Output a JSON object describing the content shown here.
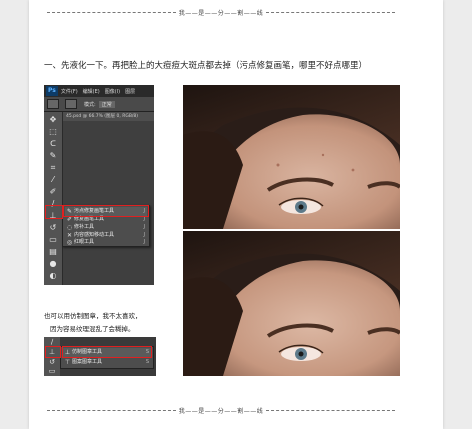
{
  "divider_text": "我——是——分——割——线",
  "heading": "一、先液化一下。再把脸上的大痘痘大斑点都去掉（污点修复画笔，哪里不好点哪里）",
  "ps1": {
    "logo": "Ps",
    "menus": [
      "文件(F)",
      "编辑(E)",
      "图像(I)",
      "图层"
    ],
    "options": [
      "模式:",
      "正常"
    ],
    "doc_tab": "45.psd @ 66.7% (图层 0, RGB/8)",
    "flyout": [
      {
        "icon": "spot-healing-brush-icon",
        "label": "污点修复画笔工具",
        "key": "J",
        "selected": true
      },
      {
        "icon": "healing-brush-icon",
        "label": "修复画笔工具",
        "key": "J",
        "selected": false
      },
      {
        "icon": "patch-icon",
        "label": "修补工具",
        "key": "J",
        "selected": false
      },
      {
        "icon": "content-aware-move-icon",
        "label": "内容感知移动工具",
        "key": "J",
        "selected": false
      },
      {
        "icon": "red-eye-icon",
        "label": "红眼工具",
        "key": "J",
        "selected": false
      }
    ]
  },
  "caption": {
    "line1": "也可以用仿制图章，我不太喜欢，",
    "line2": "因为容易纹理混乱了会糊掉。"
  },
  "ps2": {
    "flyout": [
      {
        "icon": "clone-stamp-icon",
        "label": "仿制图章工具",
        "key": "S",
        "selected": true
      },
      {
        "icon": "pattern-stamp-icon",
        "label": "图案图章工具",
        "key": "S",
        "selected": false
      }
    ]
  },
  "colors": {
    "page_bg": "#ececec",
    "sheet_bg": "#ffffff",
    "ps_panel": "#3a3a3a",
    "highlight": "#e02020"
  }
}
